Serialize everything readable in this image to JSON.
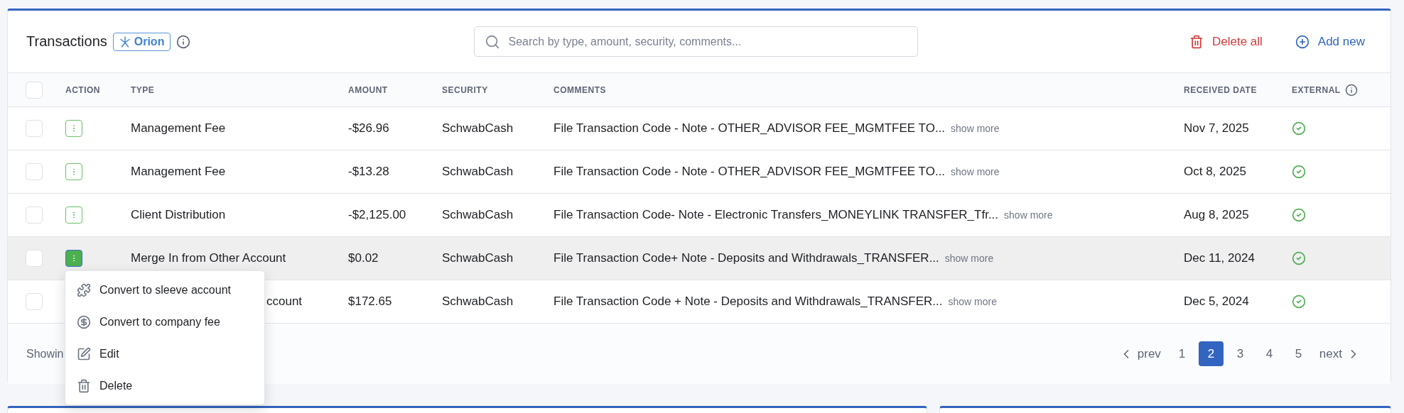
{
  "header": {
    "title": "Transactions",
    "badge": "Orion",
    "search": {
      "placeholder": "Search by type, amount, security, comments..."
    },
    "delete_all": "Delete all",
    "add_new": "Add new"
  },
  "table": {
    "select_all_checked": false,
    "columns": [
      "ACTION",
      "TYPE",
      "AMOUNT",
      "SECURITY",
      "COMMENTS",
      "RECEIVED DATE",
      "EXTERNAL"
    ],
    "rows": [
      {
        "checked": false,
        "active": false,
        "covered": false,
        "type": "Management Fee",
        "amount": "-$26.96",
        "security": "SchwabCash",
        "comment": "File Transaction Code - Note - OTHER_ADVISOR FEE_MGMTFEE TO...",
        "more": "show more",
        "date": "Nov 7, 2025",
        "external": true
      },
      {
        "checked": false,
        "active": false,
        "covered": false,
        "type": "Management Fee",
        "amount": "-$13.28",
        "security": "SchwabCash",
        "comment": "File Transaction Code - Note - OTHER_ADVISOR FEE_MGMTFEE TO...",
        "more": "show more",
        "date": "Oct 8, 2025",
        "external": true
      },
      {
        "checked": false,
        "active": false,
        "covered": false,
        "type": "Client Distribution",
        "amount": "-$2,125.00",
        "security": "SchwabCash",
        "comment": "File Transaction Code- Note - Electronic Transfers_MONEYLINK TRANSFER_Tfr...",
        "more": "show more",
        "date": "Aug 8, 2025",
        "external": true
      },
      {
        "checked": false,
        "active": true,
        "covered": false,
        "type": "Merge In from Other Account",
        "amount": "$0.02",
        "security": "SchwabCash",
        "comment": "File Transaction Code+ Note - Deposits and Withdrawals_TRANSFER...",
        "more": "show more",
        "date": "Dec 11, 2024",
        "external": true
      },
      {
        "checked": false,
        "active": false,
        "covered": true,
        "type": "ccount",
        "amount": "$172.65",
        "security": "SchwabCash",
        "comment": "File Transaction Code + Note - Deposits and Withdrawals_TRANSFER...",
        "more": "show more",
        "date": "Dec 5, 2024",
        "external": true
      }
    ]
  },
  "menu": [
    {
      "kind": "puzzle",
      "label": "Convert to sleeve account"
    },
    {
      "kind": "dollar",
      "label": "Convert to company fee"
    },
    {
      "kind": "edit",
      "label": "Edit"
    },
    {
      "kind": "delete",
      "label": "Delete"
    }
  ],
  "footer": {
    "showing": "Showin",
    "prev": "prev",
    "next": "next",
    "pages": [
      {
        "label": "1",
        "selected": false
      },
      {
        "label": "2",
        "selected": true
      },
      {
        "label": "3",
        "selected": false
      },
      {
        "label": "4",
        "selected": false
      },
      {
        "label": "5",
        "selected": false
      }
    ]
  }
}
